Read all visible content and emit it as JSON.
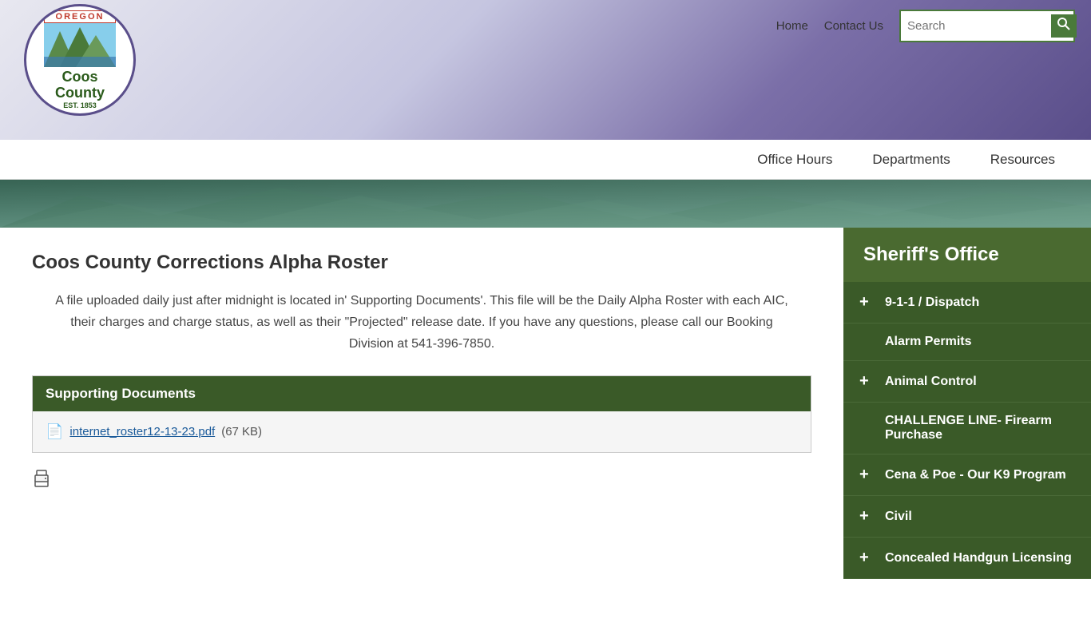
{
  "header": {
    "nav_home": "Home",
    "nav_contact": "Contact Us",
    "search_placeholder": "Search",
    "search_button_label": "🔍",
    "nav_office_hours": "Office Hours",
    "nav_departments": "Departments",
    "nav_resources": "Resources"
  },
  "logo": {
    "oregon_text": "OREGON",
    "county_name": "Coos\nCounty",
    "est_text": "EST. 1853"
  },
  "main": {
    "page_title": "Coos County Corrections Alpha Roster",
    "page_description": "A file uploaded daily just after midnight is located in' Supporting Documents'. This file will be the Daily Alpha Roster with each AIC, their charges and charge status, as well as their \"Projected\" release date. If you have any questions, please call our Booking Division at 541-396-7850.",
    "supporting_docs_header": "Supporting Documents",
    "pdf_filename": "internet_roster12-13-23.pdf",
    "pdf_size": "(67 KB)"
  },
  "sidebar": {
    "header": "Sheriff's Office",
    "items": [
      {
        "label": "9-1-1 / Dispatch",
        "has_plus": true
      },
      {
        "label": "Alarm Permits",
        "has_plus": false
      },
      {
        "label": "Animal Control",
        "has_plus": true
      },
      {
        "label": "CHALLENGE LINE- Firearm Purchase",
        "has_plus": false
      },
      {
        "label": "Cena & Poe - Our K9 Program",
        "has_plus": true
      },
      {
        "label": "Civil",
        "has_plus": true
      },
      {
        "label": "Concealed Handgun Licensing",
        "has_plus": true
      }
    ]
  },
  "colors": {
    "sidebar_bg": "#3a5a28",
    "sidebar_header_bg": "#4a6a30",
    "docs_header_bg": "#3a5a28",
    "accent_green": "#4a7a3a"
  }
}
